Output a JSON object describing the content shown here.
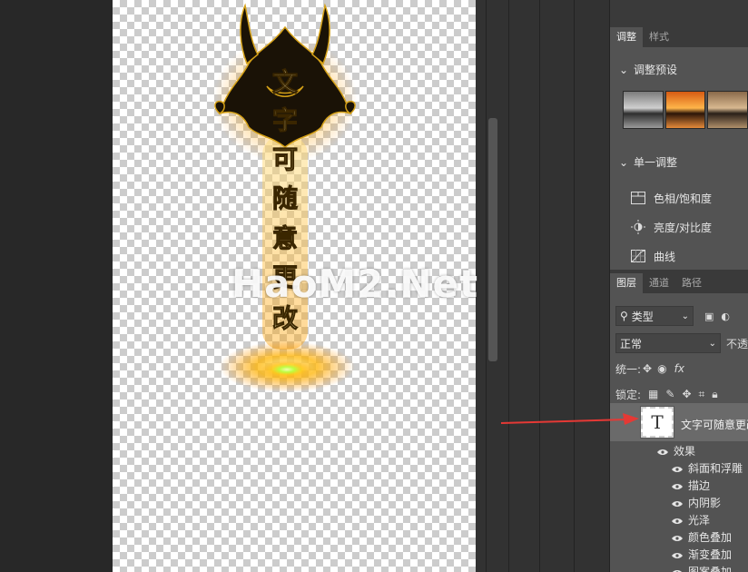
{
  "watermark": "HaoM2.Net",
  "artwork": {
    "vertical_text": [
      "文",
      "字",
      "可",
      "随",
      "意",
      "更",
      "改"
    ]
  },
  "top_tabs": {
    "tab1": "调整",
    "tab2": "样式"
  },
  "adjust_presets": {
    "label": "调整预设"
  },
  "single_adjust": {
    "label": "单一调整",
    "items": [
      "色相/饱和度",
      "亮度/对比度",
      "曲线"
    ]
  },
  "layer_tabs": {
    "tab1": "图层",
    "tab2": "通道",
    "tab3": "路径"
  },
  "layers": {
    "filter_label": "类型",
    "blend_mode": "正常",
    "opacity_label": "不透",
    "unify_label": "统一:",
    "lock_label": "锁定:",
    "layer_name": "文字可随意更改",
    "effects_label": "效果",
    "effects": [
      "斜面和浮雕",
      "描边",
      "内阴影",
      "光泽",
      "颜色叠加",
      "渐变叠加",
      "图案叠加"
    ],
    "fx_text": "fx"
  },
  "colors": {
    "arrow": "#e53935",
    "glow": "#ffb300",
    "accent_green": "#b6ff3a"
  }
}
